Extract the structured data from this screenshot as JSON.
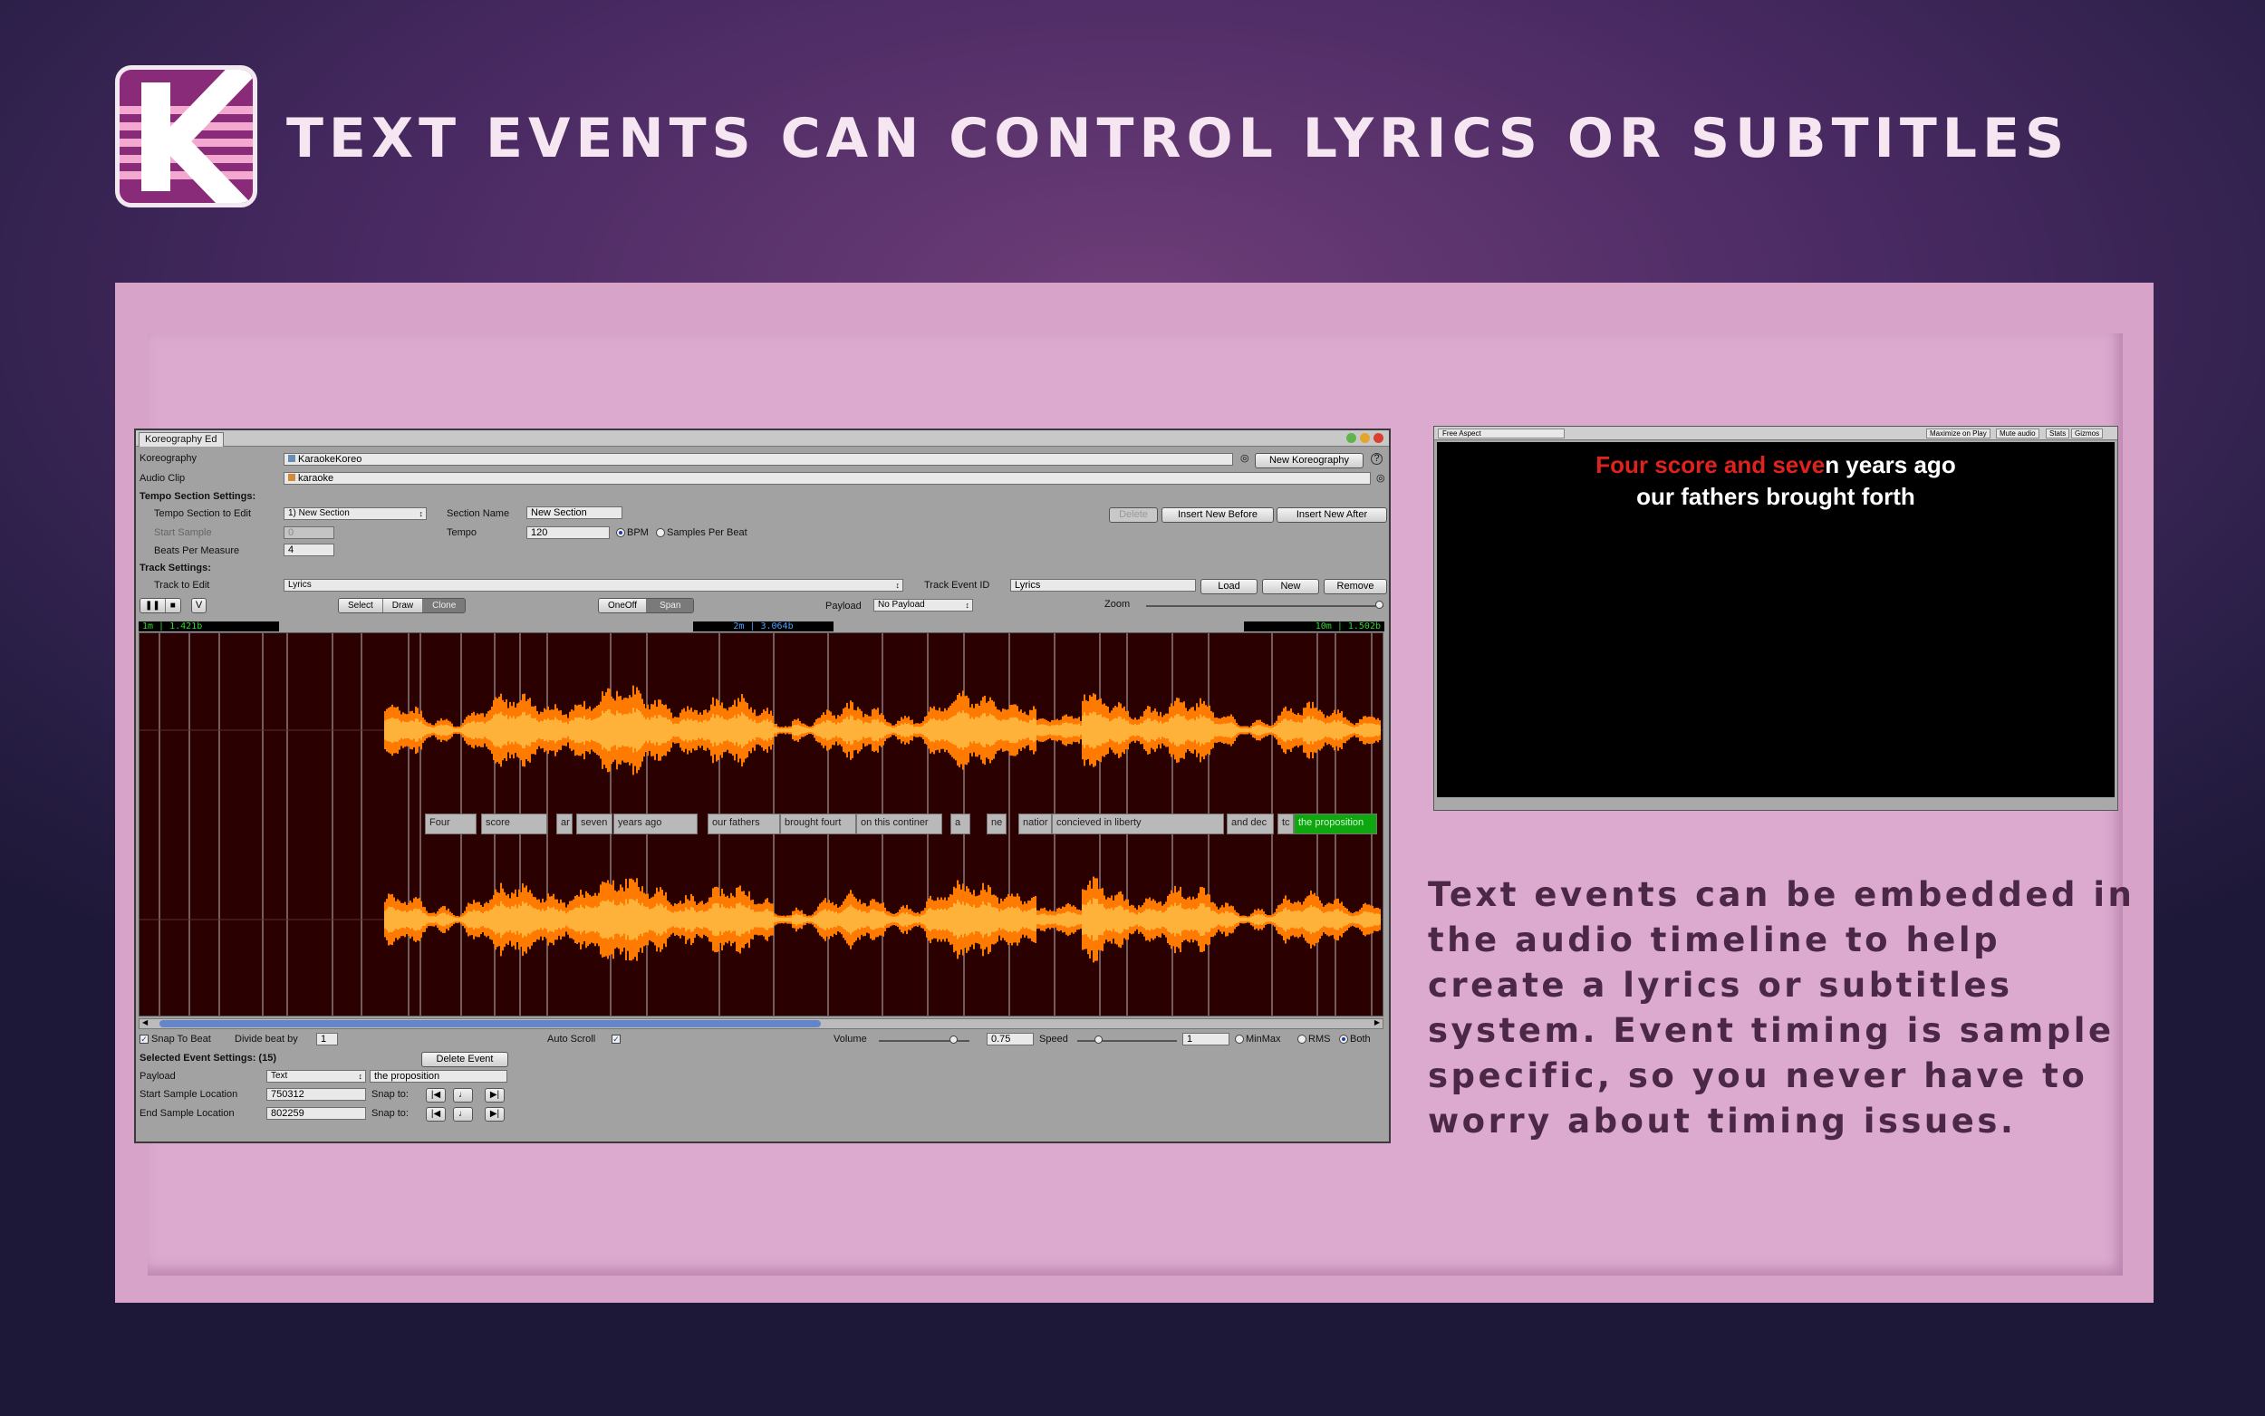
{
  "header": {
    "title": "TEXT EVENTS CAN CONTROL LYRICS OR SUBTITLES"
  },
  "editor": {
    "tab_label": "Koreography Ed",
    "koreography_label": "Koreography",
    "koreography_value": "KaraokeKoreo",
    "new_koreography_button": "New Koreography",
    "audio_clip_label": "Audio Clip",
    "audio_clip_value": "karaoke",
    "tempo_section_settings": "Tempo Section Settings:",
    "tempo_section_to_edit_label": "Tempo Section to Edit",
    "tempo_section_to_edit_value": "1) New Section",
    "section_name_label": "Section Name",
    "section_name_value": "New Section",
    "delete_button": "Delete",
    "insert_before_button": "Insert New Before",
    "insert_after_button": "Insert New After",
    "start_sample_label": "Start Sample",
    "start_sample_value": "0",
    "tempo_label": "Tempo",
    "tempo_value": "120",
    "bpm_label": "BPM",
    "samples_per_beat_label": "Samples Per Beat",
    "beats_per_measure_label": "Beats Per Measure",
    "beats_per_measure_value": "4",
    "track_settings": "Track Settings:",
    "track_to_edit_label": "Track to Edit",
    "track_to_edit_value": "Lyrics",
    "track_event_id_label": "Track Event ID",
    "track_event_id_value": "Lyrics",
    "load_button": "Load",
    "new_button": "New",
    "remove_button": "Remove",
    "play_mode_v": "V",
    "mode_select": "Select",
    "mode_draw": "Draw",
    "mode_clone": "Clone",
    "oneoff": "OneOff",
    "span": "Span",
    "payload_label": "Payload",
    "payload_value": "No Payload",
    "zoom_label": "Zoom",
    "time_left": "1m | 1.421b",
    "time_mid": "2m | 3.064b",
    "time_right": "10m | 1.502b",
    "events": [
      {
        "text": "Four"
      },
      {
        "text": "score"
      },
      {
        "text": "ar"
      },
      {
        "text": "seven"
      },
      {
        "text": "years ago"
      },
      {
        "text": "our fathers"
      },
      {
        "text": "brought fourt"
      },
      {
        "text": "on this continer"
      },
      {
        "text": "a"
      },
      {
        "text": "ne"
      },
      {
        "text": "natior"
      },
      {
        "text": "concieved in liberty"
      },
      {
        "text": "and dec"
      },
      {
        "text": "tc"
      },
      {
        "text": "the proposition"
      }
    ],
    "snap_to_beat_label": "Snap To Beat",
    "divide_beat_label": "Divide beat by",
    "divide_beat_value": "1",
    "auto_scroll_label": "Auto Scroll",
    "volume_label": "Volume",
    "volume_value": "0.75",
    "speed_label": "Speed",
    "speed_value": "1",
    "minmax_label": "MinMax",
    "rms_label": "RMS",
    "both_label": "Both",
    "selected_event_settings": "Selected Event Settings: (15)",
    "delete_event_button": "Delete Event",
    "sel_payload_label": "Payload",
    "sel_payload_value": "Text",
    "sel_payload_text": "the proposition",
    "start_sample_location_label": "Start Sample Location",
    "start_sample_location_value": "750312",
    "end_sample_location_label": "End Sample Location",
    "end_sample_location_value": "802259",
    "snap_to_label": "Snap to:"
  },
  "game": {
    "aspect": "Free Aspect",
    "maximize": "Maximize on Play",
    "mute": "Mute audio",
    "stats": "Stats",
    "gizmos": "Gizmos",
    "lyric_line1_highlight": "Four score and seve",
    "lyric_line1_rest": "n years ago",
    "lyric_line2": "our fathers brought forth"
  },
  "description": "Text events can be embedded in the audio timeline to help create a lyrics or subtitles system. Event timing is sample specific, so you never have to worry about timing issues.",
  "colors": {
    "accent": "#8a2b79",
    "panel": "#d8a3c9",
    "waveform": "#ff8a10",
    "selected_event": "#0fa70f",
    "lyric_highlight": "#e0221e"
  }
}
